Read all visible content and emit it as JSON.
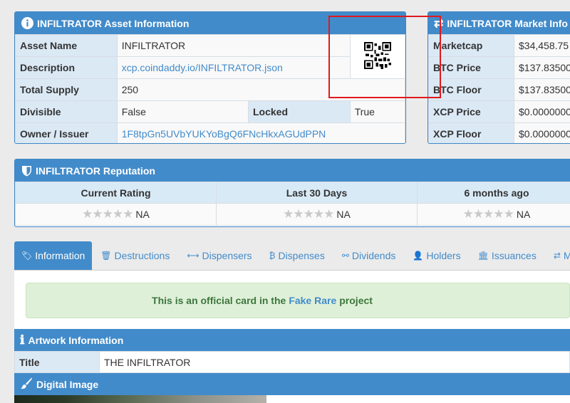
{
  "asset_panel": {
    "title": "INFILTRATOR Asset Information",
    "rows": {
      "asset_name_label": "Asset Name",
      "asset_name_value": "INFILTRATOR",
      "description_label": "Description",
      "description_value": "xcp.coindaddy.io/INFILTRATOR.json",
      "total_supply_label": "Total Supply",
      "total_supply_value": "250",
      "divisible_label": "Divisible",
      "divisible_value": "False",
      "locked_label": "Locked",
      "locked_value": "True",
      "owner_label": "Owner / Issuer",
      "owner_value": "1F8tpGn5UVbYUKYoBgQ6FNcHkxAGUdPPN"
    }
  },
  "market_panel": {
    "title": "INFILTRATOR Market Info",
    "rows": [
      {
        "label": "Marketcap",
        "value": "$34,458.75"
      },
      {
        "label": "BTC Price",
        "value": "$137.83500"
      },
      {
        "label": "BTC Floor",
        "value": "$137.83500"
      },
      {
        "label": "XCP Price",
        "value": "$0.0000000"
      },
      {
        "label": "XCP Floor",
        "value": "$0.0000000"
      }
    ]
  },
  "reputation_panel": {
    "title": "INFILTRATOR Reputation",
    "columns": [
      "Current Rating",
      "Last 30 Days",
      "6 months ago"
    ],
    "ratings": [
      "NA",
      "NA",
      "NA"
    ],
    "stars": "★★★★★"
  },
  "tabs": [
    {
      "label": "Information",
      "icon": "tag-icon",
      "glyph": "🏷"
    },
    {
      "label": "Destructions",
      "icon": "trash-icon",
      "glyph": "🗑"
    },
    {
      "label": "Dispensers",
      "icon": "arrows-h-icon",
      "glyph": "⟷"
    },
    {
      "label": "Dispenses",
      "icon": "bitcoin-icon",
      "glyph": "₿"
    },
    {
      "label": "Dividends",
      "icon": "sitemap-icon",
      "glyph": "⚯"
    },
    {
      "label": "Holders",
      "icon": "user-icon",
      "glyph": "👤"
    },
    {
      "label": "Issuances",
      "icon": "bank-icon",
      "glyph": "🏛"
    },
    {
      "label": "Mar",
      "icon": "exchange-icon",
      "glyph": "⇄"
    }
  ],
  "alert": {
    "prefix": "This is an official card in the",
    "link": "Fake Rare",
    "suffix": "project"
  },
  "artwork": {
    "title": "Artwork Information",
    "title_label": "Title",
    "title_value": "THE INFILTRATOR"
  },
  "digital_image": {
    "title": "Digital Image"
  },
  "colors": {
    "accent": "#428bca",
    "alert_bg": "#dff0d8",
    "alert_text": "#3c763d",
    "highlight_box": "#e0191c"
  }
}
